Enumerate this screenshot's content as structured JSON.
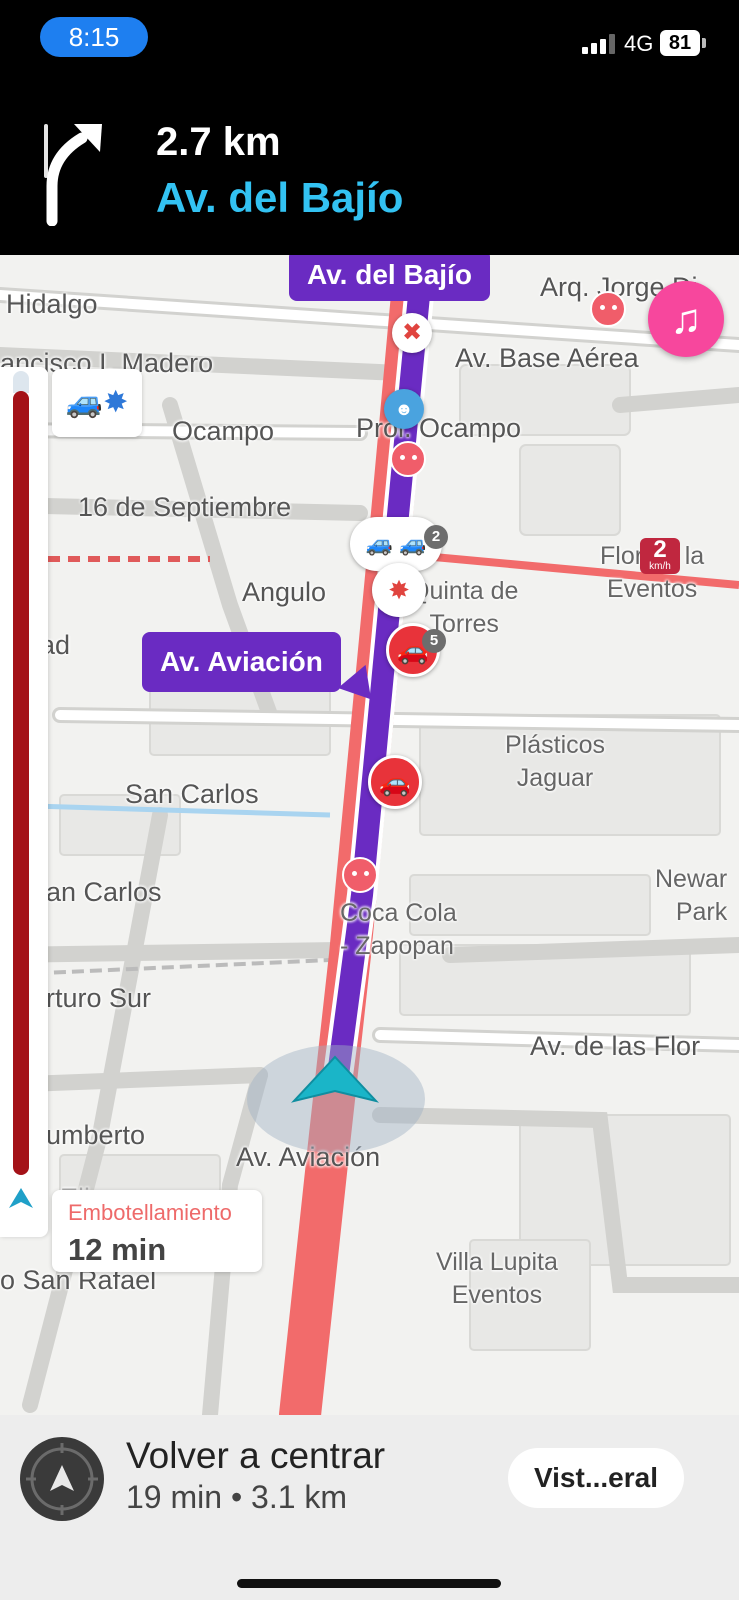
{
  "status_bar": {
    "time": "8:15",
    "network": "4G",
    "battery": "81"
  },
  "instruction": {
    "icon": "turn-right-arrow-icon",
    "distance": "2.7 km",
    "street": "Av. del Bajío",
    "street_color": "#33c2f2"
  },
  "map": {
    "route_tag_top": "Av. del Bajío",
    "route_tag_mid": "Av. Aviación",
    "route_color": "#6a2bc2",
    "traffic_color": "#f26b6b",
    "speed_badge": {
      "value": "2",
      "unit": "km/h"
    },
    "labels": {
      "hidalgo": "Hidalgo",
      "madero": "ancisco I. Madero",
      "base_aerea": "Av. Base Aérea",
      "arq_jorge": "Arq. Jorge Di",
      "ocampo": "Ocampo",
      "prol_ocampo": "Prol. Ocampo",
      "septiembre": "16 de Septiembre",
      "angulo": "Angulo",
      "quinta": "Quinta de\nTorres",
      "flor": "Flor de la\nEventos",
      "ad": "ad",
      "plasticos": "Plásticos\nJaguar",
      "san_carlos": "San Carlos",
      "san_carlos_2": "an Carlos",
      "newark": "Newar\nPark",
      "coca": "Coca Cola\n- Zapopan",
      "arturo": "rturo Sur",
      "flores": "Av. de las Flor",
      "humberto": "umberto",
      "aviacion": "Av. Aviación",
      "elisea": "Elisea",
      "san_rafael": "o San Rafael",
      "villa": "Villa Lupita\nEventos"
    },
    "alert_counts": {
      "cluster_top": "2",
      "traffic_jam": "5"
    }
  },
  "traffic_panel": {
    "jam_label": "Embotellamiento",
    "jam_time": "12 min"
  },
  "bottom_bar": {
    "recenter_label": "Volver a centrar",
    "eta": "19 min • 3.1 km",
    "overview_label": "Vist...eral"
  }
}
